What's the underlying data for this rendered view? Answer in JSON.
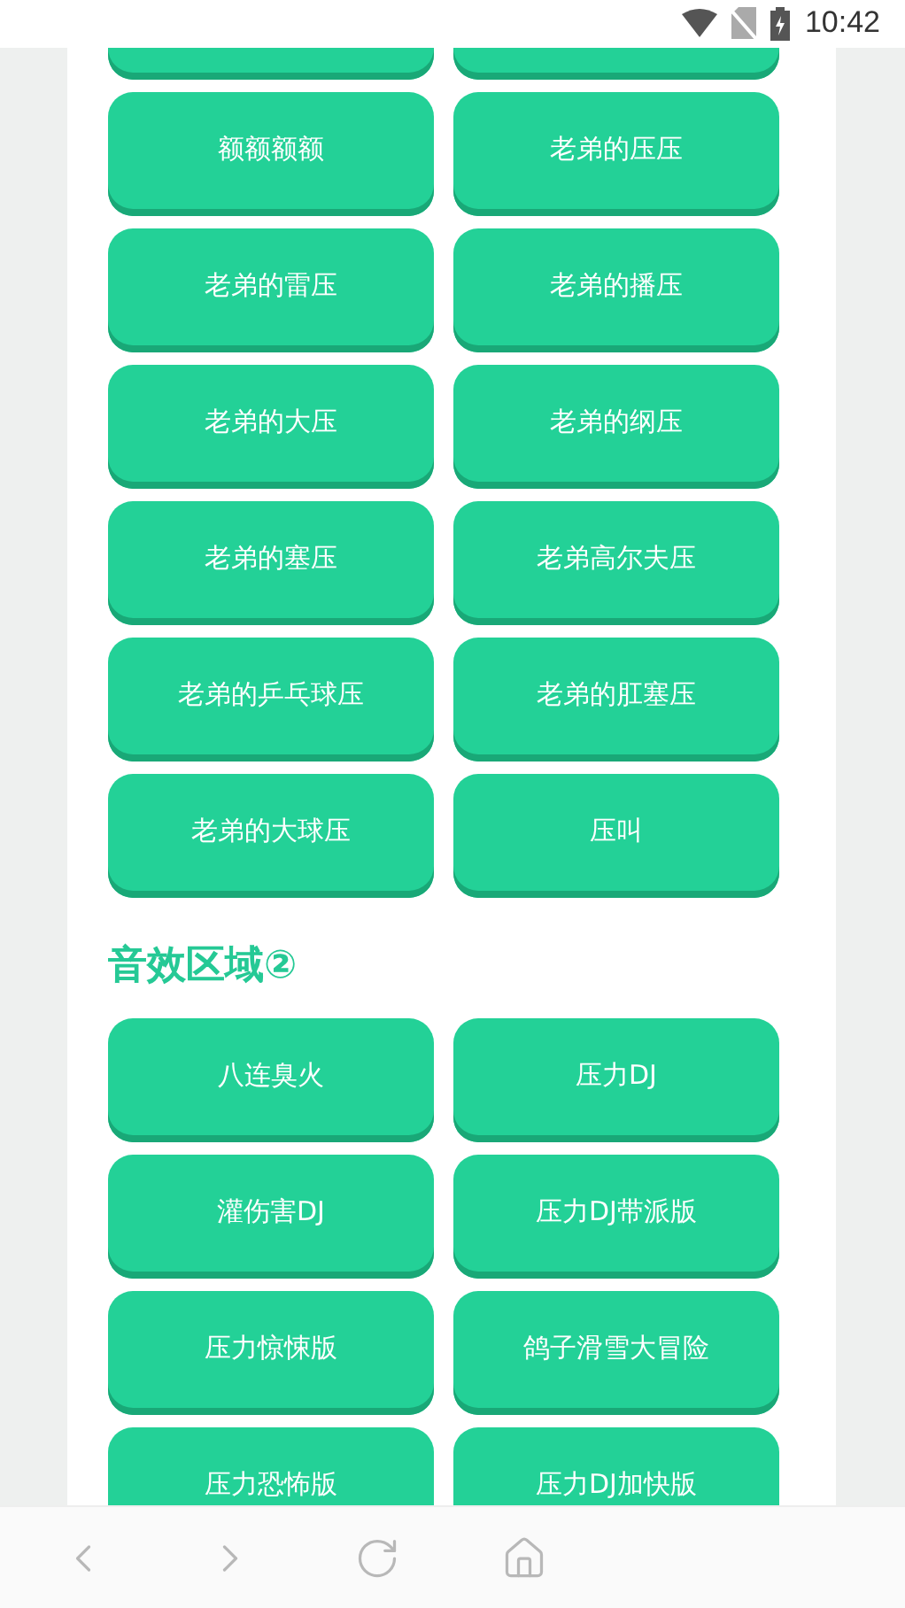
{
  "status_bar": {
    "time": "10:42"
  },
  "sections": [
    {
      "buttons": [
        "额额额额",
        "老弟的压压",
        "老弟的雷压",
        "老弟的播压",
        "老弟的大压",
        "老弟的纲压",
        "老弟的塞压",
        "老弟高尔夫压",
        "老弟的乒乓球压",
        "老弟的肛塞压",
        "老弟的大球压",
        "压叫"
      ]
    },
    {
      "title": "音效区域②",
      "buttons": [
        "八连臭火",
        "压力DJ",
        "灌伤害DJ",
        "压力DJ带派版",
        "压力惊悚版",
        "鸽子滑雪大冒险",
        "压力恐怖版",
        "压力DJ加快版"
      ]
    }
  ]
}
